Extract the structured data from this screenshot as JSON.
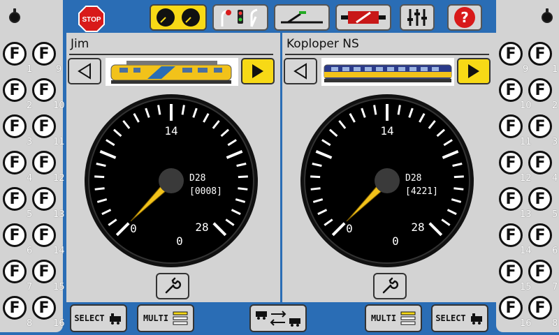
{
  "toolbar": {
    "stop_label": "STOP",
    "help_label": "?"
  },
  "function_key_label": "F",
  "left_functions": {
    "col1": [
      "1",
      "2",
      "3",
      "4",
      "5",
      "6",
      "7",
      "8"
    ],
    "col2": [
      "9",
      "10",
      "11",
      "12",
      "13",
      "14",
      "15",
      "16"
    ]
  },
  "right_functions": {
    "col1": [
      "9",
      "10",
      "11",
      "12",
      "13",
      "14",
      "15",
      "16"
    ],
    "col2": [
      "1",
      "2",
      "3",
      "4",
      "5",
      "6",
      "7",
      "8"
    ]
  },
  "locos": [
    {
      "name": "Jim",
      "gauge": {
        "top_label": "14",
        "min_label": "0",
        "max_label": "28",
        "speed": "0",
        "step_mode": "D28",
        "address": "[0008]",
        "speed_fraction": 0
      }
    },
    {
      "name": "Koploper NS",
      "gauge": {
        "top_label": "14",
        "min_label": "0",
        "max_label": "28",
        "speed": "0",
        "step_mode": "D28",
        "address": "[4221]",
        "speed_fraction": 0
      }
    }
  ],
  "bottom": {
    "select_label": "SELECT",
    "multi_label": "MULTI"
  },
  "colors": {
    "accent": "#f7d916",
    "background": "#2a6db5",
    "panel": "#d3d3d3"
  }
}
